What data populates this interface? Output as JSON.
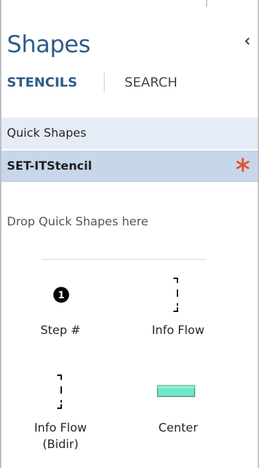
{
  "panel": {
    "title": "Shapes",
    "collapse_icon": "chevron-left-icon"
  },
  "tabs": {
    "stencils": "STENCILS",
    "search": "SEARCH"
  },
  "stencils": [
    {
      "label": "Quick Shapes",
      "selected": false
    },
    {
      "label": "SET-ITStencil",
      "selected": true,
      "modified_marker": "asterisk-icon"
    }
  ],
  "drop_hint": "Drop Quick Shapes here",
  "shapes": [
    {
      "label": "Step #",
      "icon": "step-number-icon",
      "icon_text": "1"
    },
    {
      "label": "Info Flow",
      "icon": "info-flow-icon"
    },
    {
      "label_lines": [
        "Info Flow",
        "(Bidir)"
      ],
      "icon": "info-flow-bidir-icon"
    },
    {
      "label": "Center",
      "icon": "center-box-icon"
    }
  ],
  "colors": {
    "accent": "#2e5c8a",
    "quick_shapes_bg": "#e6ecf6",
    "selected_stencil_bg": "#c7d6ea",
    "modified_star": "#e0522e",
    "center_fill": "#6ee7c8"
  }
}
